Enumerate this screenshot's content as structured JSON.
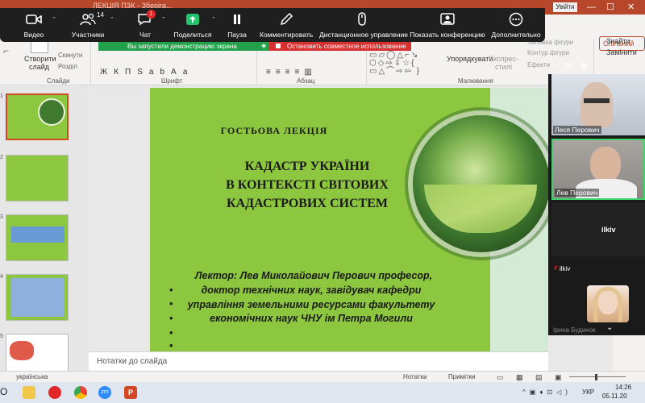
{
  "powerpoint": {
    "title_fragment": "ЛЕКЦІЯ ПЗК  -  Зберіга...",
    "signin": "Увійти",
    "share": "Спільний",
    "ribbon": {
      "create_slide": "Створити",
      "create_slide2": "слайд",
      "layout": "Макет",
      "reset": "Скинути",
      "section": "Розділ",
      "group_slides": "Слайди",
      "group_font": "Шрифт",
      "group_paragraph": "Абзац",
      "group_drawing": "Малювання",
      "arrange": "Упорядкувати",
      "quick_styles": "Експрес-",
      "quick_styles2": "стилі",
      "shape_fill": "Заливка фігури",
      "shape_outline": "Контур фігури",
      "shape_effects": "Ефекти",
      "find": "Знайти",
      "replace": "Замінити"
    },
    "notes_placeholder": "Нотатки до слайда",
    "status_language": "українська",
    "status_notes": "Нотатки",
    "status_comments": "Примітки"
  },
  "zoom_toolbar": {
    "items": [
      {
        "label": "Видео",
        "icon": "video-icon"
      },
      {
        "label": "Участники",
        "icon": "participants-icon"
      },
      {
        "label": "Чат",
        "icon": "chat-icon"
      },
      {
        "label": "Поделиться",
        "icon": "share-screen-icon"
      },
      {
        "label": "Пауза",
        "icon": "pause-icon"
      },
      {
        "label": "Комментировать",
        "icon": "annotate-icon"
      },
      {
        "label": "Дистанционное управление",
        "icon": "remote-control-icon"
      },
      {
        "label": "Показать конференцию",
        "icon": "show-meeting-icon"
      },
      {
        "label": "Дополнительно",
        "icon": "more-icon"
      }
    ],
    "participant_count": "14",
    "chat_badge": "1"
  },
  "share_notice": "Вы запустили демонстрацию экрана",
  "stop_share": "Остановить совместное использование",
  "slide": {
    "heading": "ГОСТЬОВА ЛЕКЦІЯ",
    "title_lines": [
      "КАДАСТР УКРАЇНИ",
      "В КОНТЕКСТІ  СВІТОВИХ",
      "КАДАСТРОВИХ СИСТЕМ"
    ],
    "body_lines": [
      "Лектор: Лев Миколайович Перович  професор,",
      "доктор технічних наук, завідувач кафедри",
      "управління земельними ресурсами факультету",
      "економічних наук ЧНУ ім Петра Могили"
    ]
  },
  "thumbnails": [
    "1",
    "2",
    "3",
    "4",
    "5"
  ],
  "participants": {
    "video1_name": "Леся Перович",
    "video2_name": "Лев Перович",
    "tile_name": "ilkiv",
    "muted_name": "ilkiv",
    "last_name": "Ірина Будинок"
  },
  "taskbar": {
    "lang": "УКР",
    "time": "14:26",
    "date": "05.11.20"
  },
  "colors": {
    "powerpoint_accent": "#b7472a",
    "slide_green": "#8dc63f",
    "zoom_active": "#3fd36b",
    "share_green": "#23a04a",
    "stop_red": "#d63030"
  }
}
